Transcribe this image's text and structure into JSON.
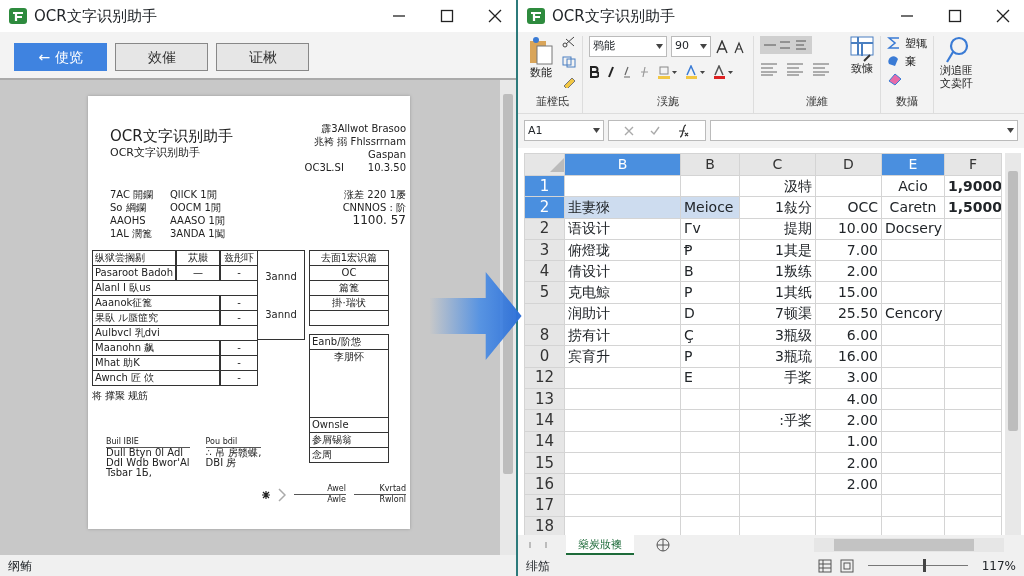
{
  "left_window": {
    "title": "OCR文字识别助手",
    "buttons": [
      {
        "label": "← 使览",
        "selected": true
      },
      {
        "label": "效催",
        "selected": false
      },
      {
        "label": "证楸",
        "selected": false
      }
    ],
    "document": {
      "title": "OCR文字识别助手",
      "subtitle": "OCR文字识别助手",
      "header_right": [
        "霹3Allwot Brasoo",
        "兆袴 搦 Fhlssrrnam",
        "Gaspan"
      ],
      "ref_label": "OC3L.SI",
      "ref_value": "10.3.50",
      "info_left": [
        [
          "7AC 開鑭",
          "QllCK 1閒"
        ],
        [
          "So 綱鑭",
          "OOCM 1閒"
        ],
        [
          "AAOHS",
          "AAASO 1閒"
        ],
        [
          "1AL 濶篦",
          "3ANDA 1闖"
        ]
      ],
      "info_right": [
        "涨差 220 1屡",
        "CNNNOS : 阶",
        "1100. 57"
      ],
      "form_left": [
        [
          "纵狱尝搁剔",
          "苁臌",
          "兹彤吓"
        ],
        [
          "Pasaroot Badoh",
          "—",
          "-"
        ],
        [
          "Alanl I 臥us"
        ],
        [
          "Aaanok征篦",
          "-"
        ],
        [
          "果臥 ル蜃篚究",
          "-"
        ],
        [
          "Aulbvcl 乳dvi"
        ],
        [
          "Maanohn 飙",
          "-"
        ],
        [
          "Mhat 助K",
          "-"
        ],
        [
          "Awnch 匠 佽",
          "-"
        ]
      ],
      "form_middle": [
        "3annd",
        "3annd"
      ],
      "form_right": [
        "去面1宏识篇",
        "OC",
        "篇篦",
        "掛·瑞状"
      ],
      "form_right_lower": {
        "heading": "Eanb/阶怹",
        "body": "李朋怀",
        "rows": [
          "Ownsle",
          "参屑锡翁",
          "念周"
        ]
      },
      "remark": "将 撑聚 规筋",
      "signatures": [
        {
          "heading": "Buil IBIE",
          "lines": [
            "Dull Btyn 0l Adl",
            "DdI Wdb Bwor'Al",
            "Tsbar 1Б,"
          ]
        },
        {
          "heading": "Pou bdil",
          "lines": [
            "∴ 吊 房赣蝶,",
            "DBI 房"
          ]
        }
      ],
      "stamps": [
        {
          "heading": "Awel",
          "line": "Awle"
        },
        {
          "heading": "Kvrtad",
          "line": "Rwlonl"
        }
      ]
    },
    "status": "纲鲔"
  },
  "right_window": {
    "title": "OCR文字识别助手",
    "ribbon": [
      {
        "kind": "clipboard",
        "label": "韮樘氐",
        "button": "数能"
      },
      {
        "kind": "font",
        "label": "渓旎",
        "font_name": "鸦能",
        "font_size": "90"
      },
      {
        "kind": "alignment",
        "label": "瀧維",
        "button": "致慷"
      },
      {
        "kind": "editing",
        "label": "数攝",
        "items": [
          "塑辄",
          "棄"
        ]
      },
      {
        "kind": "search",
        "lines": [
          "浏追匪",
          "文卖阡"
        ]
      }
    ],
    "name_box": "A1",
    "columns": [
      {
        "label": "B",
        "selected": true
      },
      {
        "label": "B",
        "selected": false
      },
      {
        "label": "C",
        "selected": false
      },
      {
        "label": "D",
        "selected": false
      },
      {
        "label": "E",
        "selected": true
      },
      {
        "label": "F",
        "selected": false
      }
    ],
    "rows": [
      {
        "header": "1",
        "selected": true,
        "highlighted": false,
        "cells": [
          "",
          "",
          "汲特",
          "",
          "Acio",
          "1,9000"
        ]
      },
      {
        "header": "2",
        "selected": true,
        "highlighted": true,
        "cells": [
          "韭妻猍",
          "Meioce",
          "1敍分",
          "OCC",
          "Caretn",
          "1,5000"
        ]
      },
      {
        "header": "2",
        "selected": false,
        "highlighted": false,
        "cells": [
          "语设计",
          "Гv",
          "提期",
          "10.00",
          "Docsery",
          ""
        ]
      },
      {
        "header": "3",
        "selected": false,
        "highlighted": false,
        "cells": [
          "俯燈珑",
          "Ᵽ",
          "1其是",
          "7.00",
          "",
          ""
        ]
      },
      {
        "header": "4",
        "selected": false,
        "highlighted": false,
        "cells": [
          "倩设计",
          "B",
          "1叛练",
          "2.00",
          "",
          ""
        ]
      },
      {
        "header": "5",
        "selected": false,
        "highlighted": false,
        "cells": [
          "克电鯨",
          "P",
          "1其纸",
          "15.00",
          "",
          ""
        ]
      },
      {
        "header": "",
        "selected": false,
        "highlighted": false,
        "cells": [
          "润助计",
          "D",
          "7顿渠",
          "25.50",
          "Cencory",
          ""
        ]
      },
      {
        "header": "8",
        "selected": false,
        "highlighted": false,
        "cells": [
          "捞有计",
          "Ç",
          "3瓶级",
          "6.00",
          "",
          ""
        ]
      },
      {
        "header": "0",
        "selected": false,
        "highlighted": false,
        "cells": [
          "宾育升",
          "P",
          "3瓶琉",
          "16.00",
          "",
          ""
        ]
      },
      {
        "header": "12",
        "selected": false,
        "highlighted": false,
        "cells": [
          "",
          "E",
          "手桨",
          "3.00",
          "",
          ""
        ]
      },
      {
        "header": "13",
        "selected": false,
        "highlighted": false,
        "cells": [
          "",
          "",
          "",
          "4.00",
          "",
          ""
        ]
      },
      {
        "header": "14",
        "selected": false,
        "highlighted": false,
        "cells": [
          "",
          "",
          ":乎桨",
          "2.00",
          "",
          ""
        ]
      },
      {
        "header": "14",
        "selected": false,
        "highlighted": false,
        "cells": [
          "",
          "",
          "",
          "1.00",
          "",
          ""
        ]
      },
      {
        "header": "15",
        "selected": false,
        "highlighted": false,
        "cells": [
          "",
          "",
          "",
          "2.00",
          "",
          ""
        ]
      },
      {
        "header": "16",
        "selected": false,
        "highlighted": false,
        "cells": [
          "",
          "",
          "",
          "2.00",
          "",
          ""
        ]
      },
      {
        "header": "17",
        "selected": false,
        "highlighted": false,
        "cells": [
          "",
          "",
          "",
          "",
          "",
          ""
        ]
      },
      {
        "header": "18",
        "selected": false,
        "highlighted": false,
        "cells": [
          "",
          "",
          "",
          "",
          "",
          ""
        ]
      }
    ],
    "sheet_tabs": [
      {
        "label": "燊炭妝襖",
        "selected": true
      }
    ],
    "status": "绯笳",
    "zoom": {
      "level": 0.55,
      "reading": "117%"
    }
  }
}
